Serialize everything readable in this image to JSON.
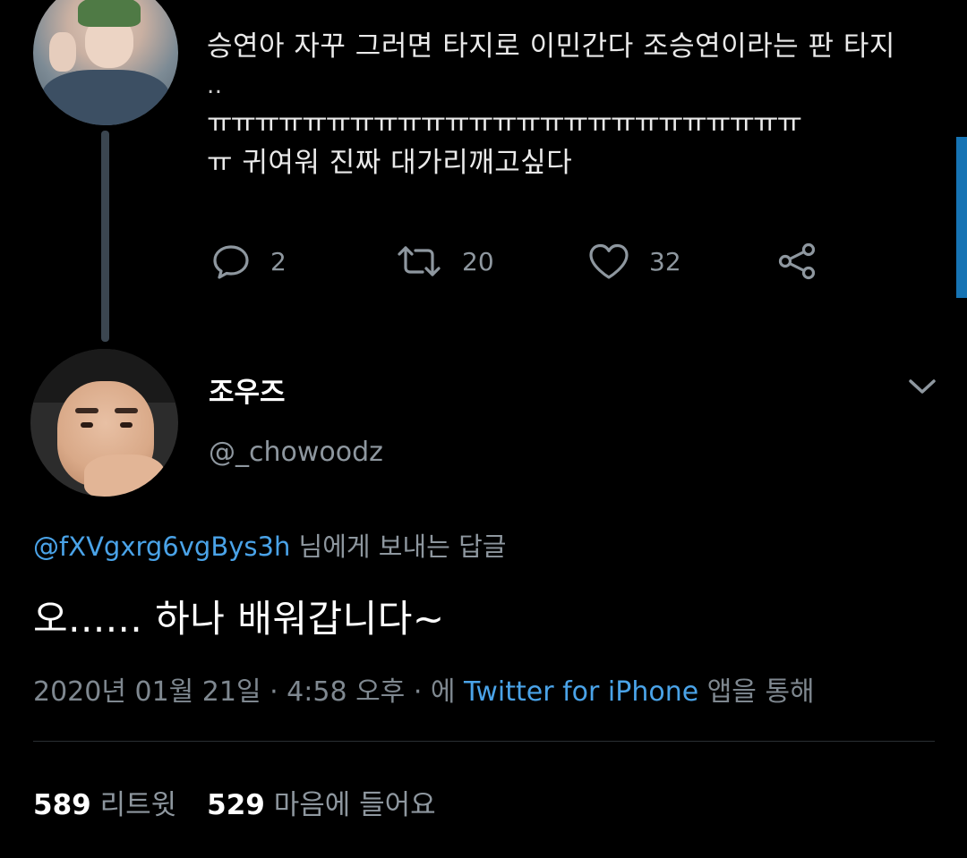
{
  "parent_tweet": {
    "text_lines": [
      "승연아 자꾸 그러면 타지로 이민간다 조승연이라는 판 타지",
      "..",
      "ㅠㅠㅠㅠㅠㅠㅠㅠㅠㅠㅠㅠㅠㅠㅠㅠㅠㅠㅠㅠㅠㅠㅠㅠㅠ",
      "ㅠ 귀여워 진짜 대가리깨고싶다"
    ],
    "actions": {
      "reply_count": "2",
      "retweet_count": "20",
      "like_count": "32"
    }
  },
  "main_tweet": {
    "display_name": "조우즈",
    "handle": "@_chowoodz",
    "reply_to_mention": "@fXVgxrg6vgBys3h",
    "reply_to_suffix": "님에게 보내는 답글",
    "text": "오...... 하나 배워갑니다~",
    "meta_date": "2020년 01월 21일 · 4:58 오후 · 에 ",
    "meta_source": "Twitter for iPhone",
    "meta_suffix": " 앱을 통해",
    "stats": {
      "retweets": "589",
      "retweets_label": "리트윗",
      "likes": "529",
      "likes_label": "마음에 들어요"
    }
  },
  "colors": {
    "background": "#000000",
    "accent": "#4aa3e8",
    "muted_text": "#8e979f"
  },
  "icons": [
    "reply-icon",
    "retweet-icon",
    "like-icon",
    "share-icon",
    "chevron-down-icon"
  ]
}
